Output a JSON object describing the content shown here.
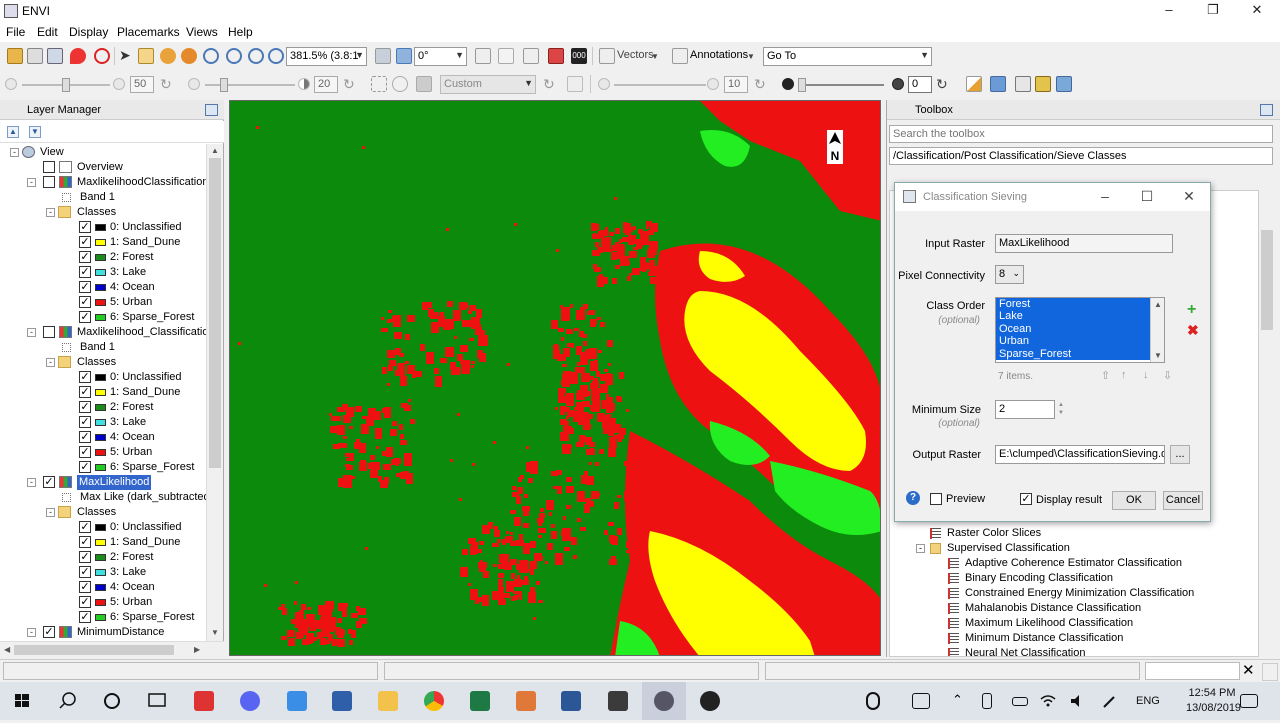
{
  "window": {
    "title": "ENVI"
  },
  "menu": [
    "File",
    "Edit",
    "Display",
    "Placemarks",
    "Views",
    "Help"
  ],
  "toolbar1": {
    "zoom_value": "381.5% (3.8:1",
    "rotation_value": "0°",
    "vectors_label": "Vectors",
    "annotations_label": "Annotations",
    "goto_value": "Go To"
  },
  "toolbar2": {
    "brightness": "50",
    "contrast": "20",
    "stretch_value": "Custom",
    "sharpen": "10",
    "transparency": "0"
  },
  "layer_manager": {
    "title": "Layer Manager",
    "rows": [
      {
        "label": "View"
      },
      {
        "label": "Overview"
      },
      {
        "label": "MaxlikelihoodClassificationCl"
      },
      {
        "label": "Band 1"
      },
      {
        "label": "Classes"
      },
      {
        "label": "0: Unclassified"
      },
      {
        "label": "1: Sand_Dune"
      },
      {
        "label": "2: Forest"
      },
      {
        "label": "3: Lake"
      },
      {
        "label": "4: Ocean"
      },
      {
        "label": "5: Urban"
      },
      {
        "label": "6: Sparse_Forest"
      },
      {
        "label": "Maxlikelihood_ClassificationS"
      },
      {
        "label": "Band 1"
      },
      {
        "label": "Classes"
      },
      {
        "label": "0: Unclassified"
      },
      {
        "label": "1: Sand_Dune"
      },
      {
        "label": "2: Forest"
      },
      {
        "label": "3: Lake"
      },
      {
        "label": "4: Ocean"
      },
      {
        "label": "5: Urban"
      },
      {
        "label": "6: Sparse_Forest"
      },
      {
        "label": "MaxLikelihood"
      },
      {
        "label": "Max Like (dark_subtracted)"
      },
      {
        "label": "Classes"
      },
      {
        "label": "0: Unclassified"
      },
      {
        "label": "1: Sand_Dune"
      },
      {
        "label": "2: Forest"
      },
      {
        "label": "3: Lake"
      },
      {
        "label": "4: Ocean"
      },
      {
        "label": "5: Urban"
      },
      {
        "label": "6: Sparse_Forest"
      },
      {
        "label": "MinimumDistance"
      }
    ],
    "class_colors": [
      "#000000",
      "#ffff00",
      "#1a8a1a",
      "#40e0e0",
      "#0000cc",
      "#ee1111",
      "#22cc22"
    ]
  },
  "map": {
    "north_label": "N",
    "colors": {
      "forest": "#0b8a0b",
      "urban": "#ee1111",
      "sand": "#ffff00",
      "sparse": "#22ee22"
    }
  },
  "toolbox": {
    "title": "Toolbox",
    "search_placeholder": "Search the toolbox",
    "path": "/Classification/Post Classification/Sieve Classes",
    "items": [
      {
        "label": "Raster Color Slices"
      },
      {
        "label": "Supervised Classification"
      },
      {
        "label": "Adaptive Coherence Estimator Classification"
      },
      {
        "label": "Binary Encoding Classification"
      },
      {
        "label": "Constrained Energy Minimization Classification"
      },
      {
        "label": "Mahalanobis Distance Classification"
      },
      {
        "label": "Maximum Likelihood Classification"
      },
      {
        "label": "Minimum Distance Classification"
      },
      {
        "label": "Neural Net Classification"
      }
    ]
  },
  "dialog": {
    "title": "Classification Sieving",
    "input_raster_label": "Input Raster",
    "input_raster_value": "MaxLikelihood",
    "pixel_connectivity_label": "Pixel Connectivity",
    "pixel_connectivity_value": "8",
    "class_order_label": "Class Order",
    "optional_label": "(optional)",
    "class_order_items": [
      "Forest",
      "Lake",
      "Ocean",
      "Urban",
      "Sparse_Forest"
    ],
    "items_count": "7 items.",
    "minimum_size_label": "Minimum Size",
    "minimum_size_value": "2",
    "output_raster_label": "Output Raster",
    "output_raster_value": "E:\\clumped\\ClassificationSieving.dat",
    "browse_label": "...",
    "preview_label": "Preview",
    "display_result_label": "Display result",
    "ok_label": "OK",
    "cancel_label": "Cancel"
  },
  "taskbar": {
    "language": "ENG",
    "time": "12:54 PM",
    "date": "13/08/2019"
  }
}
